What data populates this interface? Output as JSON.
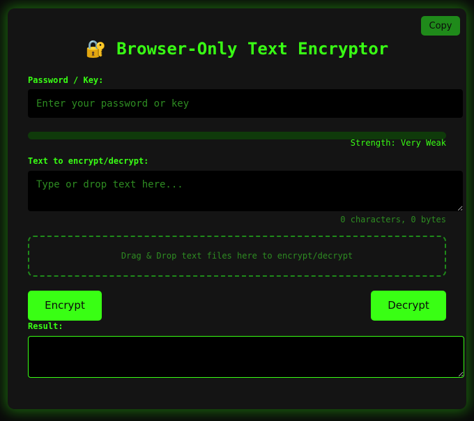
{
  "header": {
    "copy_label": "Copy",
    "title": "🔐 Browser-Only Text Encryptor"
  },
  "password": {
    "label": "Password / Key:",
    "placeholder": "Enter your password or key",
    "value": ""
  },
  "strength": {
    "text": "Strength: Very Weak",
    "level": 0
  },
  "text_input": {
    "label": "Text to encrypt/decrypt:",
    "placeholder": "Type or drop text here...",
    "value": "",
    "count": "0 characters, 0 bytes"
  },
  "drop_zone": {
    "text": "Drag & Drop text files here to encrypt/decrypt"
  },
  "actions": {
    "encrypt_label": "Encrypt",
    "decrypt_label": "Decrypt"
  },
  "result": {
    "label": "Result:",
    "value": ""
  },
  "colors": {
    "accent": "#39ff14",
    "panel": "#141414",
    "field": "#000000",
    "muted": "#2e8c22"
  }
}
